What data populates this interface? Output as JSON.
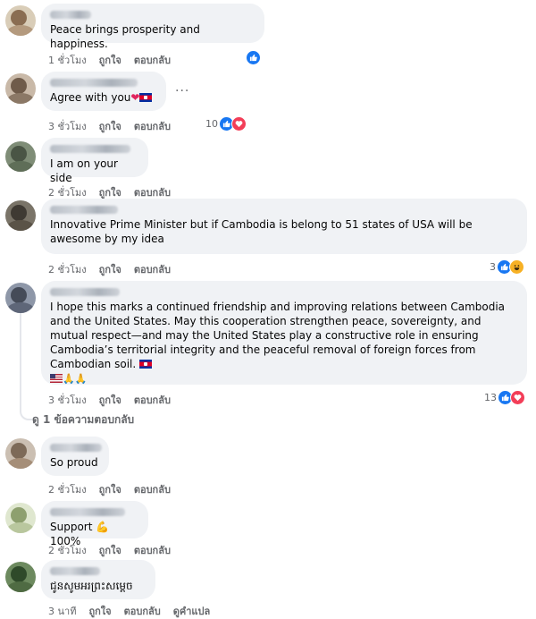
{
  "comments": [
    {
      "text": "Peace brings prosperity and happiness.",
      "time": "1 ชั่วโมง",
      "like": "ถูกใจ",
      "reply": "ตอบกลับ",
      "reaction_count": ""
    },
    {
      "text": "Agree with you",
      "time": "3 ชั่วโมง",
      "like": "ถูกใจ",
      "reply": "ตอบกลับ",
      "reaction_count": "10",
      "more": "···"
    },
    {
      "text": "I am on your side",
      "time": "2 ชั่วโมง",
      "like": "ถูกใจ",
      "reply": "ตอบกลับ"
    },
    {
      "text": "Innovative Prime Minister but if Cambodia is belong to 51 states of USA will be awesome by my idea",
      "time": "2 ชั่วโมง",
      "like": "ถูกใจ",
      "reply": "ตอบกลับ",
      "reaction_count": "3"
    },
    {
      "text": "I hope this marks a continued friendship and improving relations between Cambodia and the United States. May this cooperation strengthen peace, sovereignty, and mutual respect—and may the United States play a constructive role in ensuring Cambodia’s territorial integrity and the peaceful removal of foreign forces from Cambodian soil.",
      "time": "3 ชั่วโมง",
      "like": "ถูกใจ",
      "reply": "ตอบกลับ",
      "reaction_count": "13"
    },
    {
      "text": "So proud",
      "time": "2 ชั่วโมง",
      "like": "ถูกใจ",
      "reply": "ตอบกลับ"
    },
    {
      "text_before": "Support ",
      "text_after": " 100%",
      "time": "2 ชั่วโมง",
      "like": "ถูกใจ",
      "reply": "ตอบกลับ"
    },
    {
      "text": "ជូនសូមអរព្រះសម្តេច",
      "time": "3 นาที",
      "like": "ถูกใจ",
      "reply": "ตอบกลับ",
      "translate": "ดูคำแปล"
    }
  ],
  "view_replies": "ดู 1 ข้อความตอบกลับ",
  "colors": {
    "like": "#1877f2",
    "love": "#f33e58",
    "haha": "#f7b125",
    "bubble": "#f0f2f5",
    "meta": "#65676b"
  }
}
